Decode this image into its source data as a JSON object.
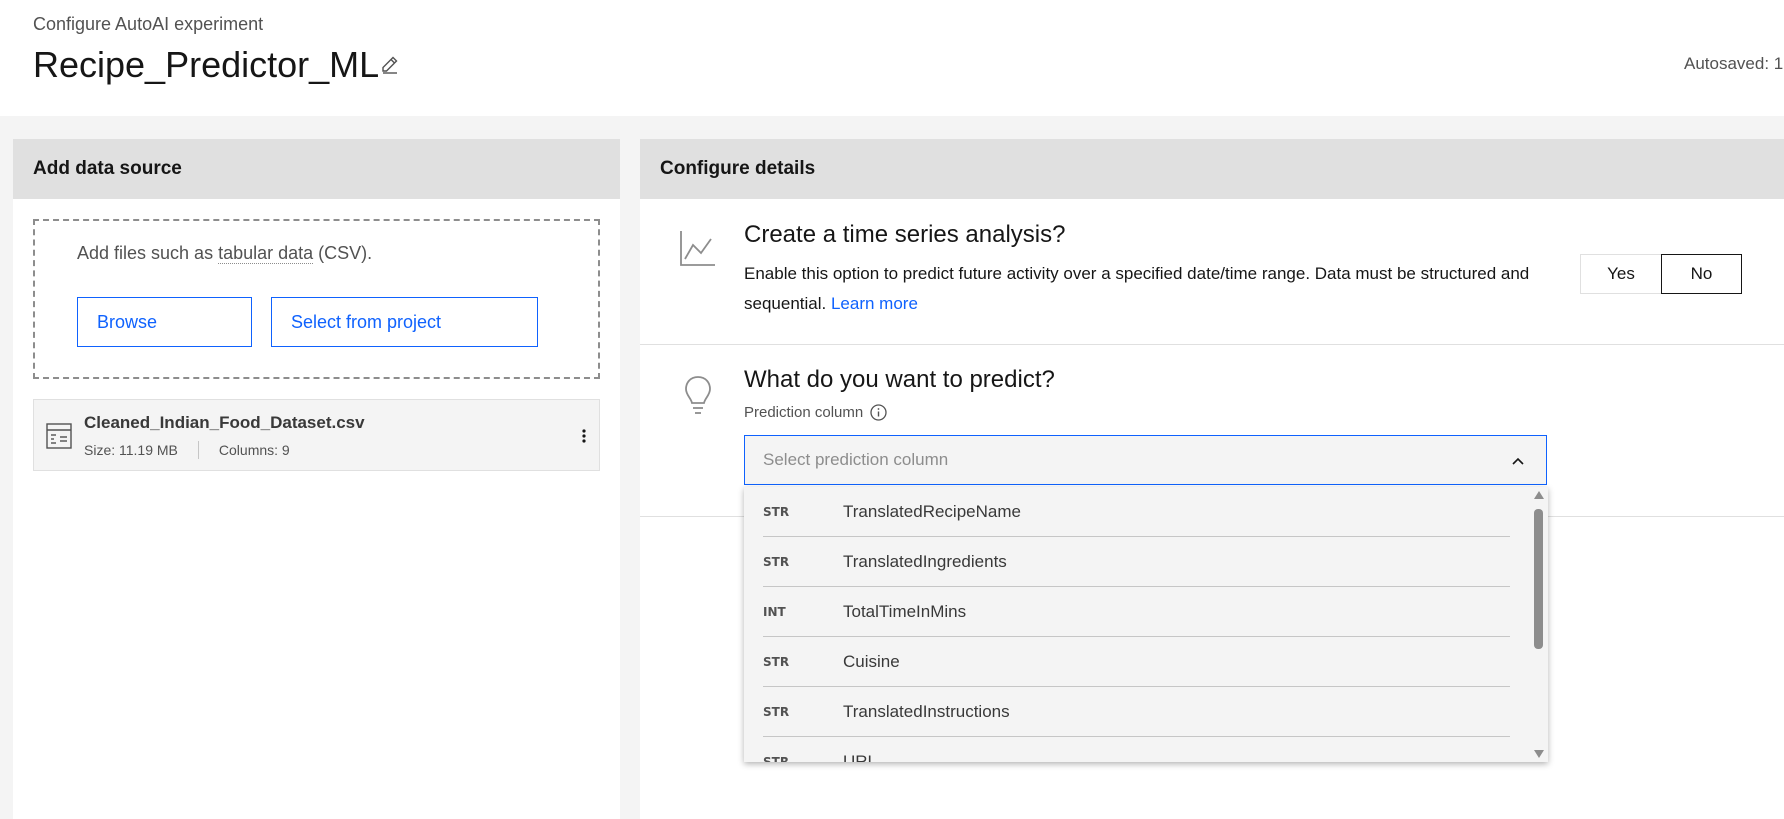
{
  "header": {
    "eyebrow": "Configure AutoAI experiment",
    "title": "Recipe_Predictor_ML",
    "autosaved": "Autosaved: 1"
  },
  "data_source": {
    "heading": "Add data source",
    "drop_text_prefix": "Add files such as ",
    "drop_text_link": "tabular data",
    "drop_text_suffix": " (CSV).",
    "browse_label": "Browse",
    "select_label": "Select from project",
    "file": {
      "name": "Cleaned_Indian_Food_Dataset.csv",
      "size": "Size: 11.19 MB",
      "columns": "Columns: 9"
    }
  },
  "details": {
    "heading": "Configure details",
    "time_series": {
      "title": "Create a time series analysis?",
      "description": "Enable this option to predict future activity over a specified date/time range. Data must be structured and sequential.",
      "learn_more": "Learn more",
      "yes_label": "Yes",
      "no_label": "No",
      "selected": "No"
    },
    "predict": {
      "title": "What do you want to predict?",
      "field_label": "Prediction column",
      "placeholder": "Select prediction column",
      "options": [
        {
          "type": "STR",
          "name": "TranslatedRecipeName"
        },
        {
          "type": "STR",
          "name": "TranslatedIngredients"
        },
        {
          "type": "INT",
          "name": "TotalTimeInMins"
        },
        {
          "type": "STR",
          "name": "Cuisine"
        },
        {
          "type": "STR",
          "name": "TranslatedInstructions"
        },
        {
          "type": "STR",
          "name": "URL"
        }
      ]
    }
  },
  "colors": {
    "accent": "#0f62fe",
    "panel_header": "#e0e0e0",
    "background": "#f4f4f4"
  }
}
